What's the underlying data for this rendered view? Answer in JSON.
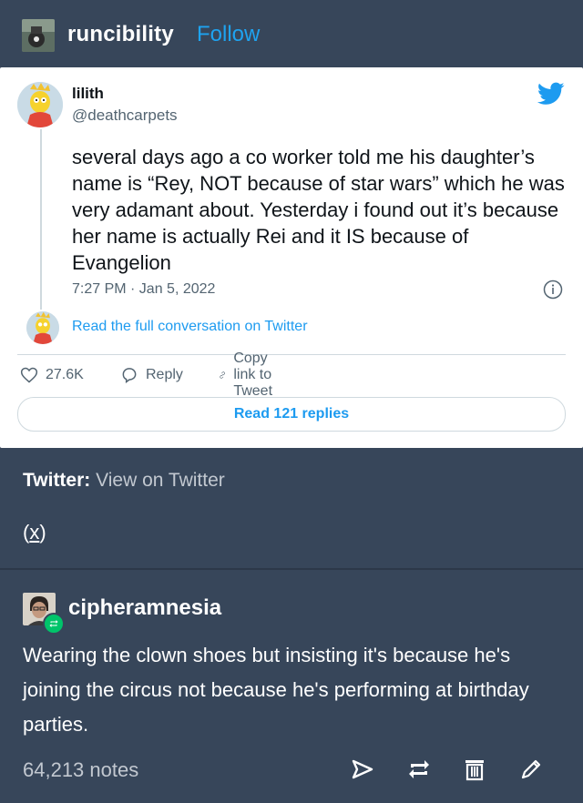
{
  "post": {
    "author": "runcibility",
    "follow_label": "Follow"
  },
  "tweet": {
    "display_name": "lilith",
    "handle": "@deathcarpets",
    "text": "several days ago a co worker told me his daughter’s name is “Rey, NOT because of star wars” which he was very adamant about. Yesterday i found out it’s because her name is actually Rei and it IS because of Evangelion",
    "timestamp": "7:27 PM · Jan 5, 2022",
    "read_conversation": "Read the full conversation on Twitter",
    "likes": "27.6K",
    "reply_label": "Reply",
    "copy_link_label": "Copy link to Tweet",
    "read_replies": "Read 121 replies",
    "twitter_blue": "#1d9bf0"
  },
  "source": {
    "label": "Twitter:",
    "link_text": "View on Twitter",
    "x_link": "x"
  },
  "reblog": {
    "user": "cipheramnesia",
    "text": "Wearing the clown shoes but insisting it's because he's joining the circus not because he's performing at birthday parties.",
    "badge_color": "#00c46a"
  },
  "footer": {
    "notes": "64,213 notes",
    "icons": [
      "share-icon",
      "reblog-icon",
      "delete-icon",
      "edit-icon"
    ]
  },
  "theme": {
    "background": "#37465a",
    "follow_color": "#1ea3f0"
  }
}
